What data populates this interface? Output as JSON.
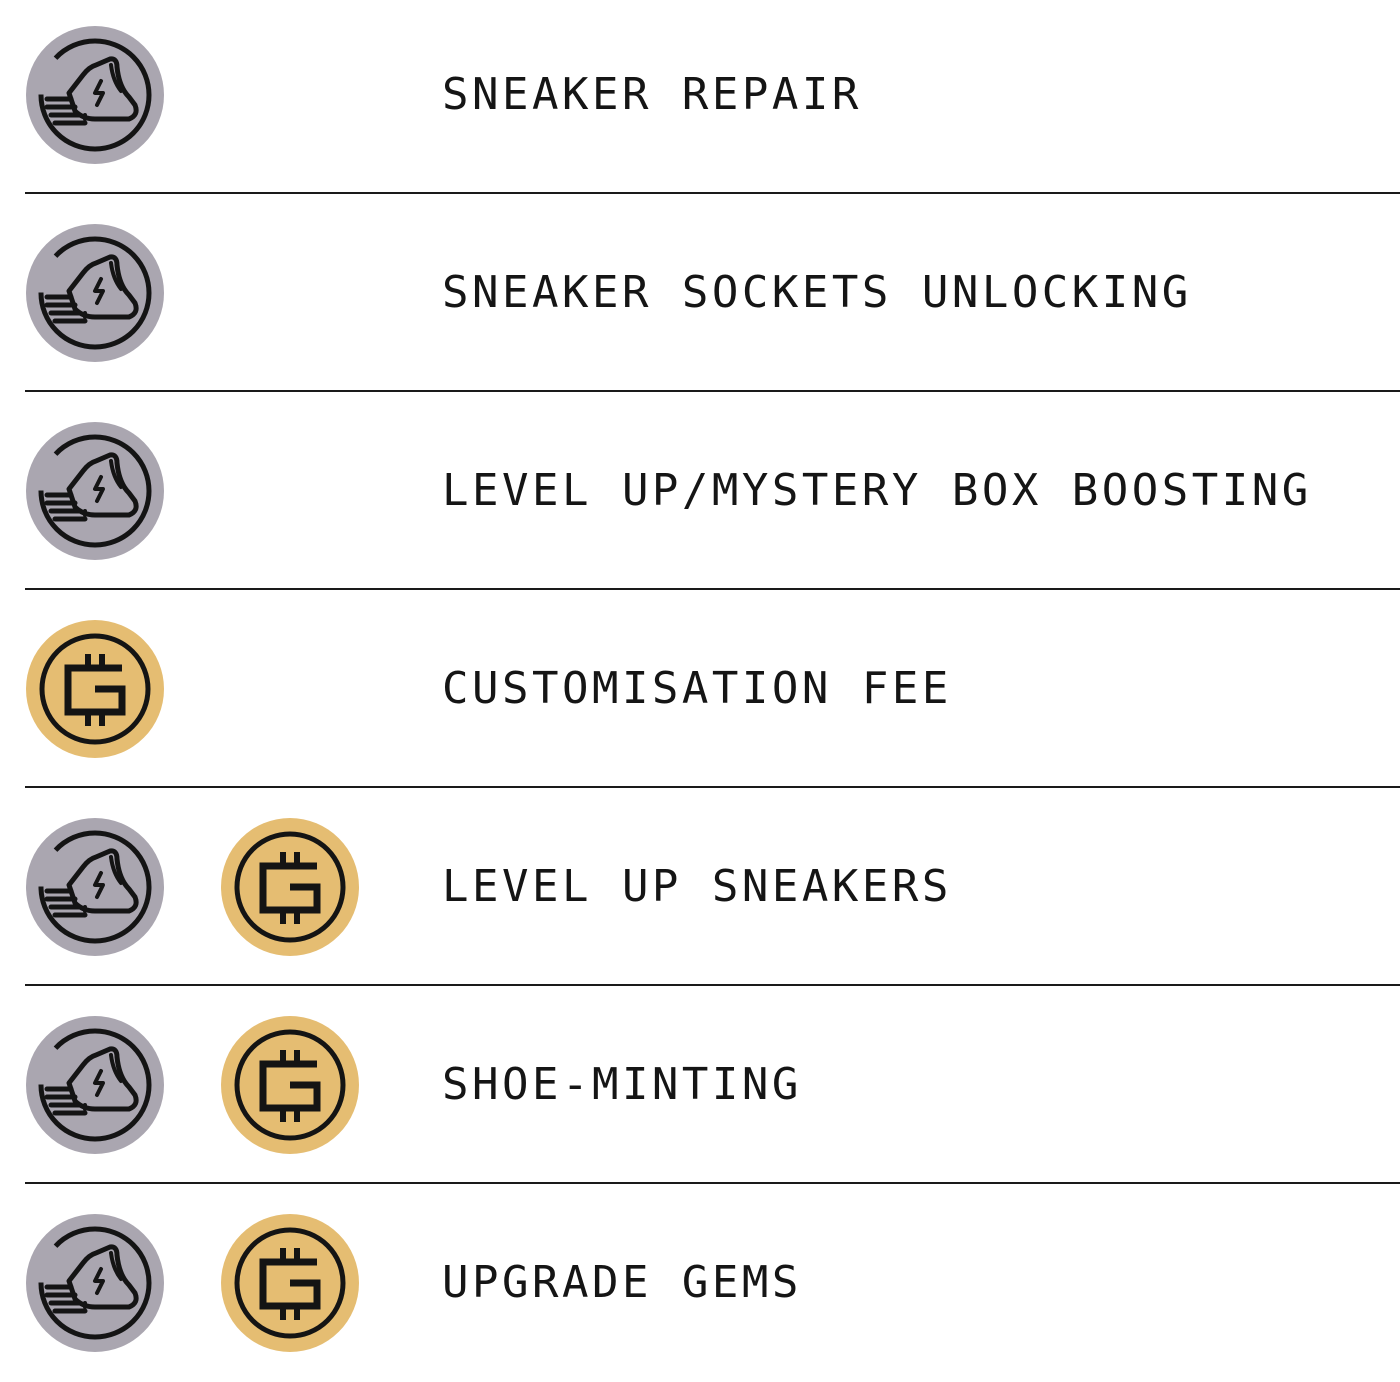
{
  "colors": {
    "gst_coin": "#aaa6b0",
    "gmt_coin": "#e5bd72",
    "ink": "#141414",
    "divider": "#1a1a1a"
  },
  "rows": [
    {
      "label": "SNEAKER REPAIR",
      "icons": [
        "sneaker-coin-icon"
      ]
    },
    {
      "label": "SNEAKER SOCKETS UNLOCKING",
      "icons": [
        "sneaker-coin-icon"
      ]
    },
    {
      "label": "LEVEL UP/MYSTERY BOX BOOSTING",
      "icons": [
        "sneaker-coin-icon"
      ]
    },
    {
      "label": "CUSTOMISATION FEE",
      "icons": [
        "gmt-coin-icon"
      ]
    },
    {
      "label": "LEVEL UP SNEAKERS",
      "icons": [
        "sneaker-coin-icon",
        "gmt-coin-icon"
      ]
    },
    {
      "label": "SHOE-MINTING",
      "icons": [
        "sneaker-coin-icon",
        "gmt-coin-icon"
      ]
    },
    {
      "label": "UPGRADE GEMS",
      "icons": [
        "sneaker-coin-icon",
        "gmt-coin-icon"
      ]
    }
  ]
}
